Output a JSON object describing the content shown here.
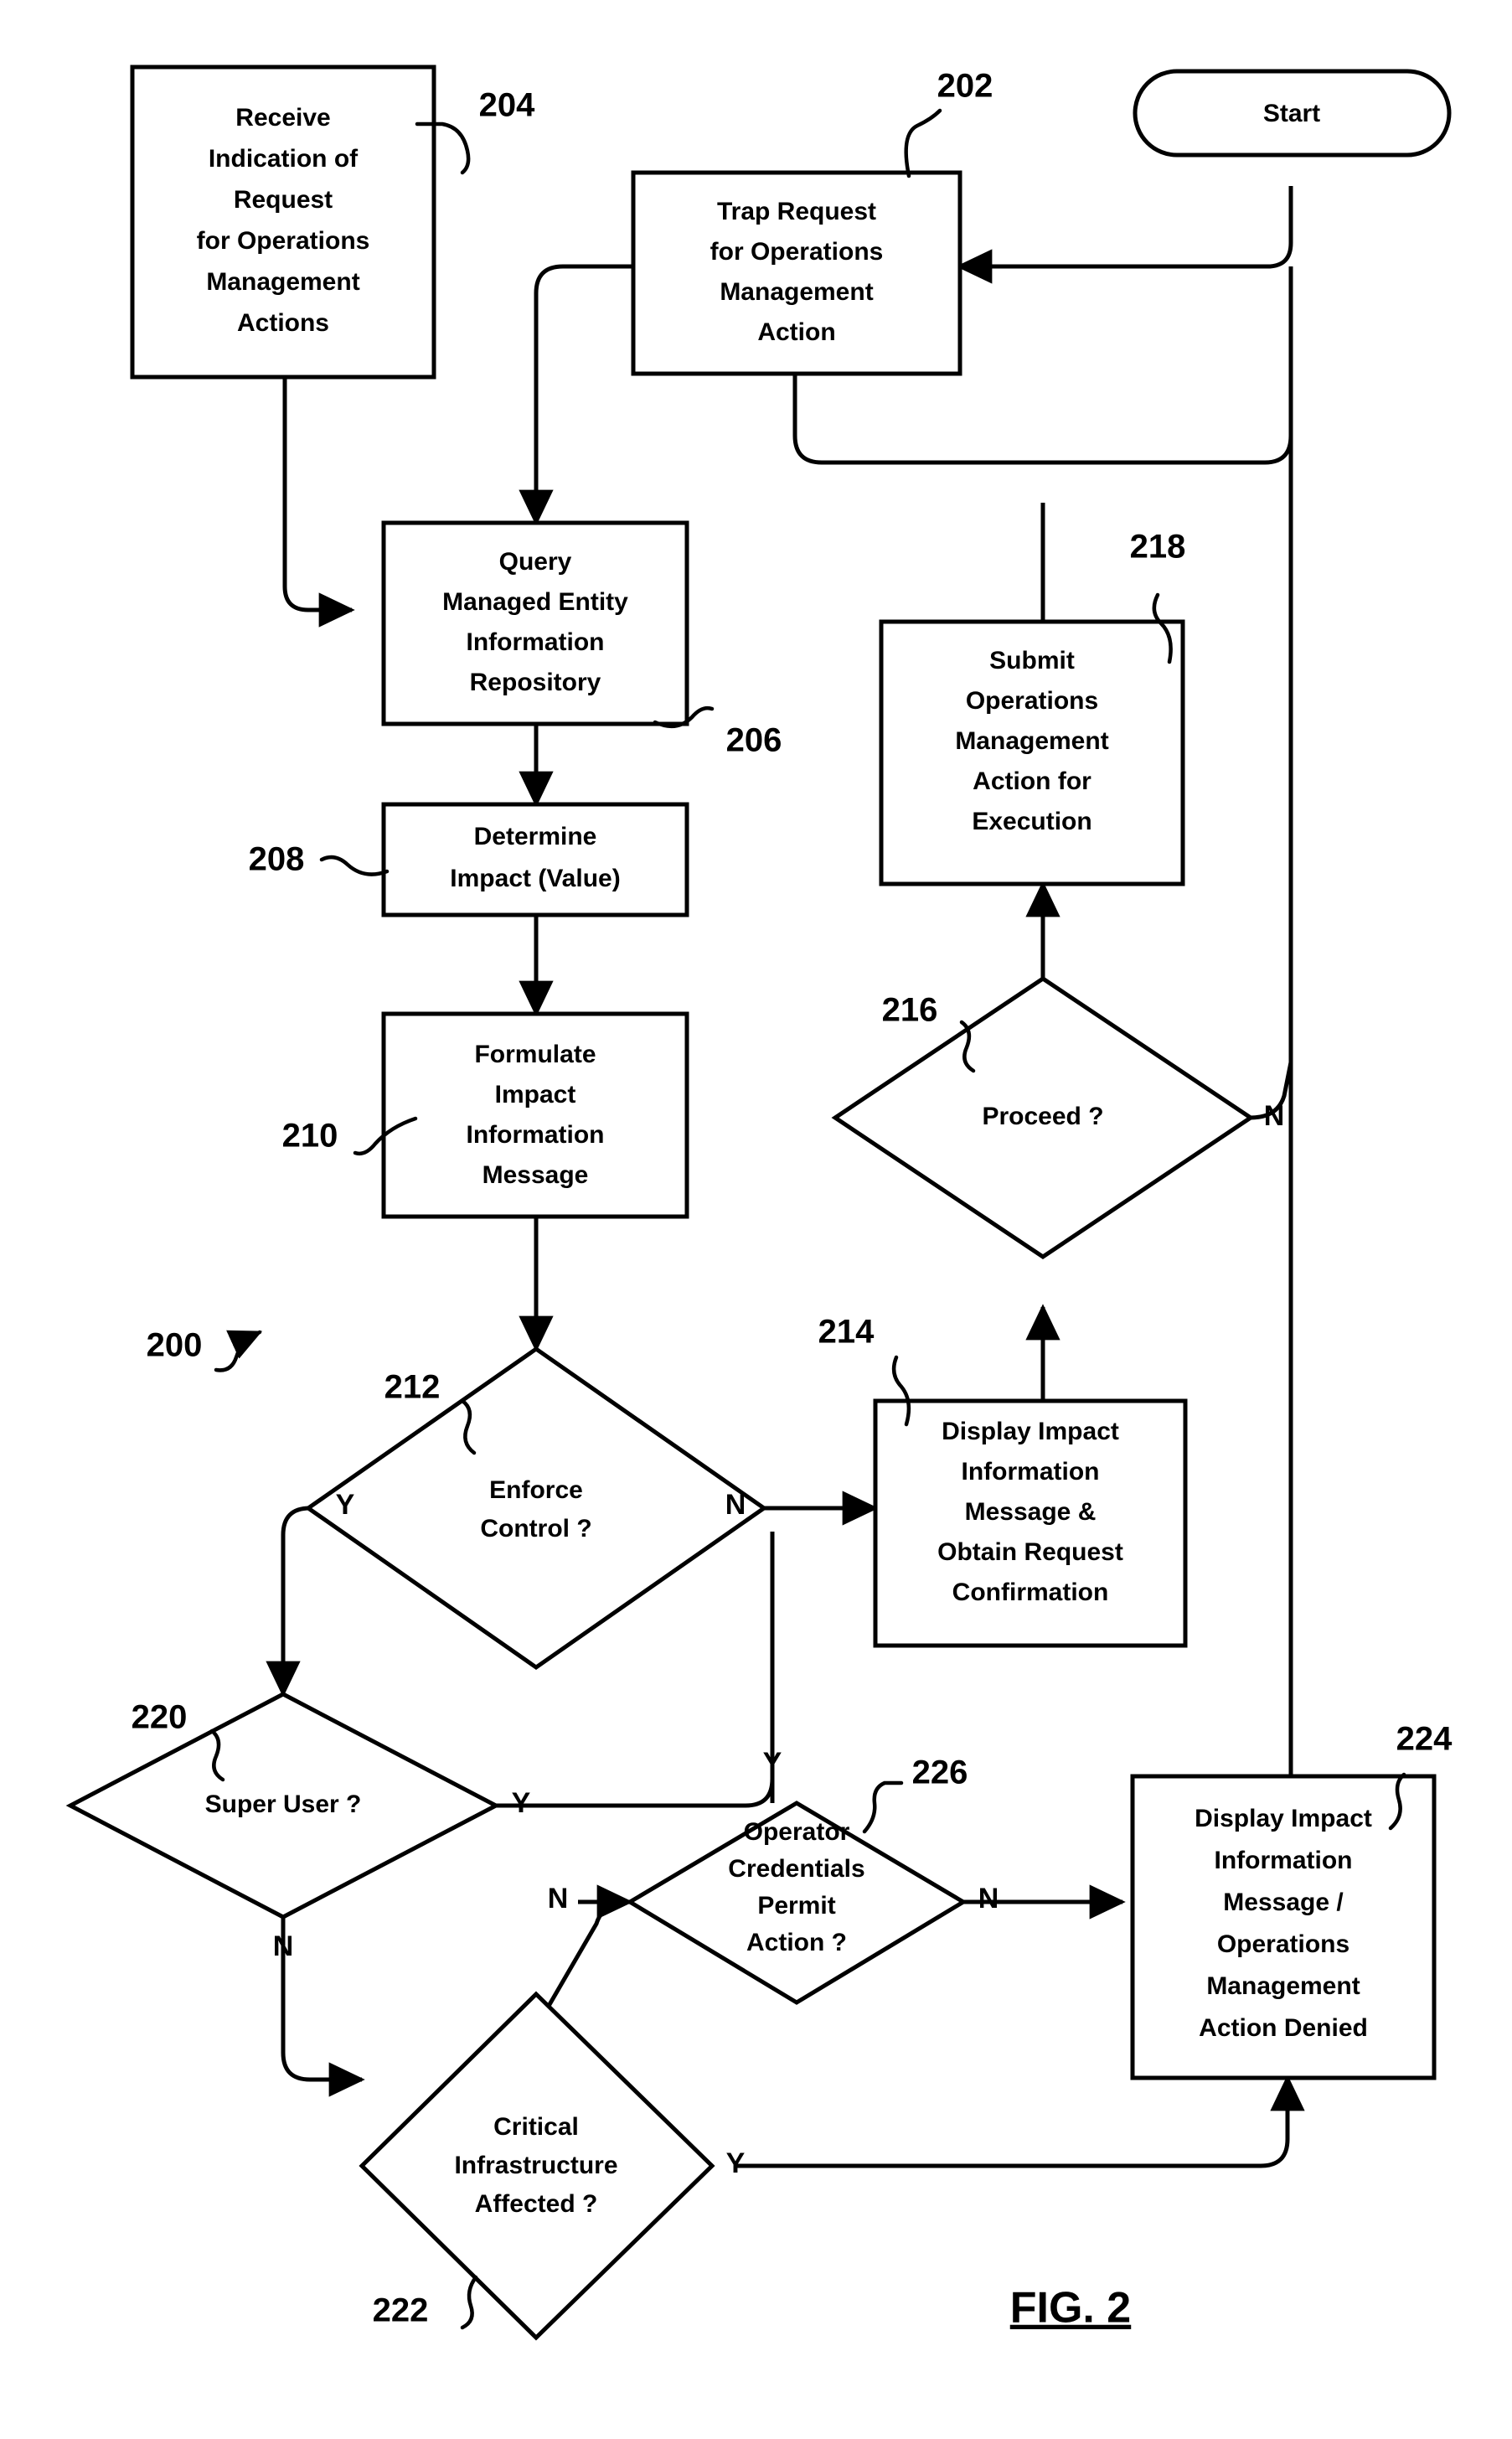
{
  "figure": {
    "caption": "FIG. 2",
    "overall_ref": "200"
  },
  "nodes": {
    "start": {
      "ref": "",
      "label": "Start",
      "shape": "terminator"
    },
    "trap_request": {
      "ref": "202",
      "lines": [
        "Trap Request",
        "for Operations",
        "Management",
        "Action"
      ],
      "shape": "process"
    },
    "receive_indication": {
      "ref": "204",
      "lines": [
        "Receive",
        "Indication of",
        "Request",
        "for Operations",
        "Management",
        "Actions"
      ],
      "shape": "process"
    },
    "query_repository": {
      "ref": "206",
      "lines": [
        "Query",
        "Managed Entity",
        "Information",
        "Repository"
      ],
      "shape": "process"
    },
    "determine_impact": {
      "ref": "208",
      "lines": [
        "Determine",
        "Impact (Value)"
      ],
      "shape": "process"
    },
    "formulate_message": {
      "ref": "210",
      "lines": [
        "Formulate",
        "Impact",
        "Information",
        "Message"
      ],
      "shape": "process"
    },
    "enforce_control": {
      "ref": "212",
      "lines": [
        "Enforce",
        "Control ?"
      ],
      "shape": "decision"
    },
    "display_confirm": {
      "ref": "214",
      "lines": [
        "Display Impact",
        "Information",
        "Message &",
        "Obtain Request",
        "Confirmation"
      ],
      "shape": "process"
    },
    "proceed": {
      "ref": "216",
      "lines": [
        "Proceed ?"
      ],
      "shape": "decision"
    },
    "submit_action": {
      "ref": "218",
      "lines": [
        "Submit",
        "Operations",
        "Management",
        "Action for",
        "Execution"
      ],
      "shape": "process"
    },
    "super_user": {
      "ref": "220",
      "lines": [
        "Super User ?"
      ],
      "shape": "decision"
    },
    "critical_infra": {
      "ref": "222",
      "lines": [
        "Critical",
        "Infrastructure",
        "Affected ?"
      ],
      "shape": "decision"
    },
    "action_denied": {
      "ref": "224",
      "lines": [
        "Display Impact",
        "Information",
        "Message /",
        "Operations",
        "Management",
        "Action Denied"
      ],
      "shape": "process"
    },
    "operator_credentials": {
      "ref": "226",
      "lines": [
        "Operator",
        "Credentials",
        "Permit",
        "Action ?"
      ],
      "shape": "decision"
    }
  },
  "branch_labels": {
    "enforce_control_yes": "Y",
    "enforce_control_no": "N",
    "proceed_no": "N",
    "super_user_yes": "Y",
    "super_user_no": "N",
    "operator_credentials_in": "N",
    "operator_credentials_no": "N",
    "operator_credentials_yes": "Y",
    "critical_infra_yes": "Y"
  },
  "colors": {
    "stroke": "#000000",
    "fill": "#ffffff",
    "text": "#000000"
  }
}
